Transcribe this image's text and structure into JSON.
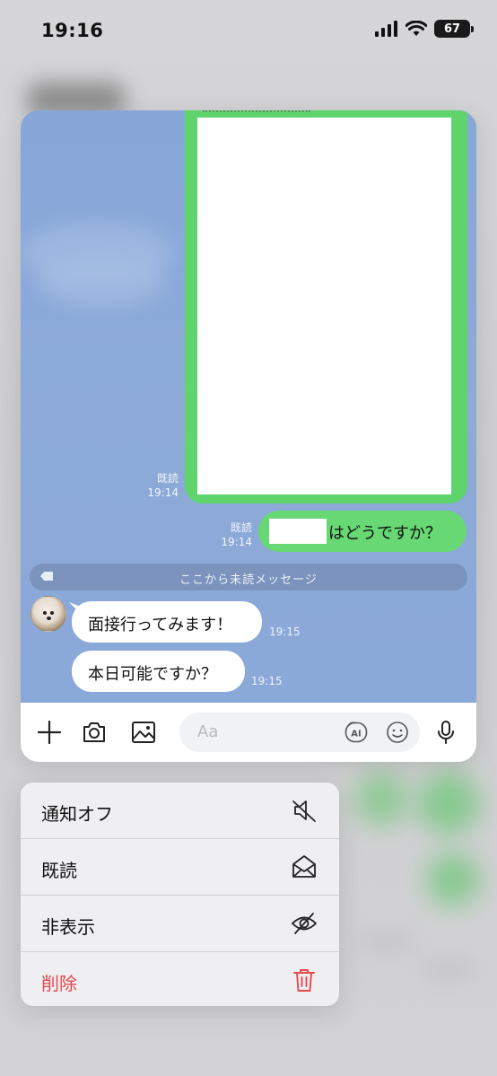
{
  "status_bar": {
    "time": "19:16",
    "battery": "67"
  },
  "chat": {
    "image_read_label": "既読",
    "image_time": "19:14",
    "sent_read_label": "既読",
    "sent_time": "19:14",
    "sent_text": "はどうですか？",
    "unread_divider": "ここから未読メッセージ",
    "received": [
      {
        "text": "面接行ってみます！",
        "time": "19:15"
      },
      {
        "text": "本日可能ですか？",
        "time": "19:15"
      }
    ]
  },
  "input_bar": {
    "placeholder": "Aa",
    "ai_label": "AI"
  },
  "context_menu": {
    "items": [
      {
        "label": "通知オフ",
        "icon": "mute-icon"
      },
      {
        "label": "既読",
        "icon": "envelope-open-icon"
      },
      {
        "label": "非表示",
        "icon": "eye-slash-icon"
      },
      {
        "label": "削除",
        "icon": "trash-icon"
      }
    ]
  },
  "colors": {
    "sent_bubble": "#67d874",
    "chat_background": "#8aa8d8",
    "destructive": "#e5484d"
  }
}
